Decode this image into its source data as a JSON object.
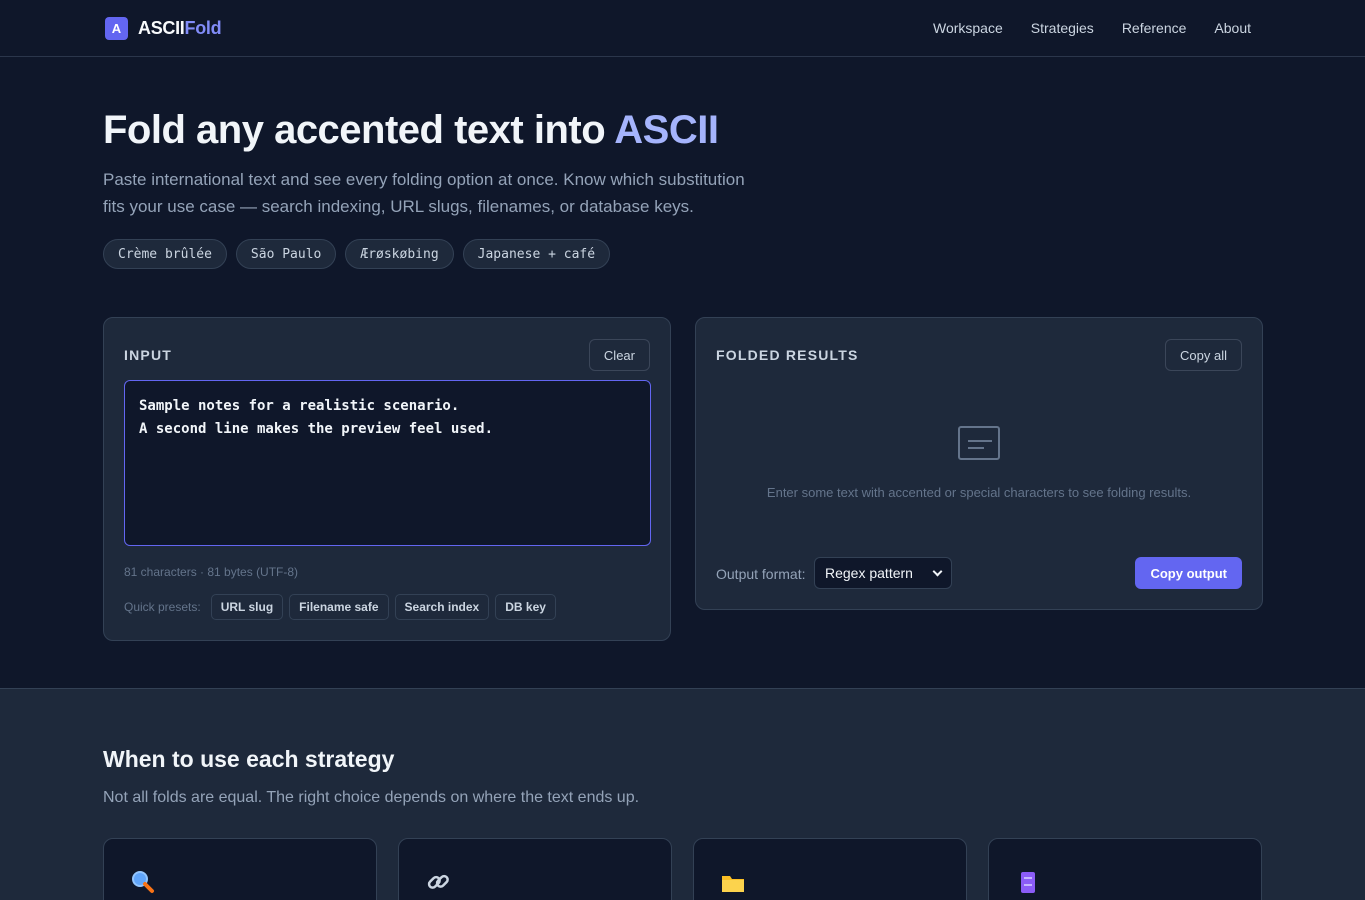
{
  "nav": {
    "brand_mark": "A",
    "brand_name_main": "ASCII",
    "brand_name_accent": "Fold",
    "links": [
      "Workspace",
      "Strategies",
      "Reference",
      "About"
    ]
  },
  "hero": {
    "title_main": "Fold any accented text into ",
    "title_accent": "ASCII",
    "subtitle": "Paste international text and see every folding option at once. Know which substitution fits your use case — search indexing, URL slugs, filenames, or database keys.",
    "chips": [
      "Crème brûlée",
      "São Paulo",
      "Ærøskøbing",
      "Japanese + café"
    ]
  },
  "input_panel": {
    "title": "INPUT",
    "clear_label": "Clear",
    "text_value": "Sample notes for a realistic scenario.\nA second line makes the preview feel used.",
    "char_count": "81 characters · 81 bytes (UTF-8)",
    "presets_label": "Quick presets:",
    "presets": [
      "URL slug",
      "Filename safe",
      "Search index",
      "DB key"
    ]
  },
  "results_panel": {
    "title": "FOLDED RESULTS",
    "copy_all_label": "Copy all",
    "empty_message": "Enter some text with accented or special characters to see folding results.",
    "format_label": "Output format:",
    "format_selected": "Regex pattern",
    "copy_output_label": "Copy output"
  },
  "strategies": {
    "title": "When to use each strategy",
    "subtitle": "Not all folds are equal. The right choice depends on where the text ends up.",
    "card_icons": [
      "magnifier-icon",
      "link-icon",
      "folder-icon",
      "database-icon"
    ]
  },
  "colors": {
    "background": "#0f172a",
    "surface": "#1e293b",
    "accent": "#6366f1",
    "accent_light": "#a5b4fc"
  }
}
